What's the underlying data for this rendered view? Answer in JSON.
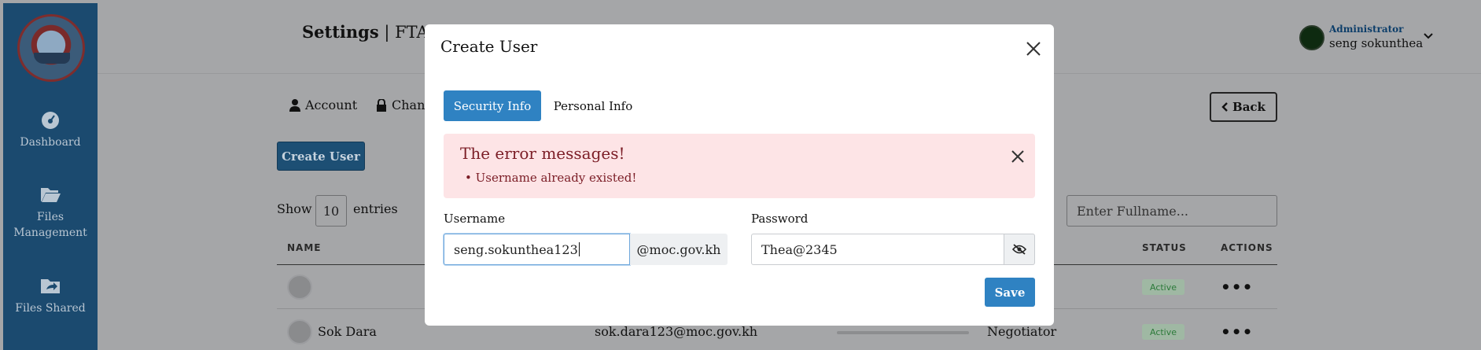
{
  "sidebar": {
    "items": [
      {
        "label": "Dashboard",
        "icon": "gauge-icon"
      },
      {
        "label": "Files Management",
        "icon": "folder-open-icon"
      },
      {
        "label": "Files Shared",
        "icon": "folder-share-icon"
      }
    ]
  },
  "header": {
    "title_bold": "Settings",
    "title_rest": " | FTA K",
    "user_role": "Administrator",
    "user_name": "seng sokunthea"
  },
  "tabs": {
    "account": "Account",
    "change": "Chang"
  },
  "back_label": "Back",
  "create_user_label": "Create User",
  "table": {
    "show_label": "Show",
    "entries_value": "10",
    "entries_label": "entries",
    "fullname_placeholder": "Enter Fullname...",
    "headers": {
      "name": "NAME",
      "status": "STATUS",
      "actions": "ACTIONS"
    },
    "rows": [
      {
        "name": "",
        "email": "",
        "role": "",
        "status": "Active"
      },
      {
        "name": "Sok Dara",
        "email": "sok.dara123@moc.gov.kh",
        "role": "Negotiator",
        "status": "Active"
      }
    ]
  },
  "modal": {
    "title": "Create User",
    "tabs": {
      "security": "Security Info",
      "personal": "Personal Info"
    },
    "alert": {
      "title": "The error messages!",
      "items": [
        "• Username already existed!"
      ]
    },
    "username": {
      "label": "Username",
      "value": "seng.sokunthea123",
      "suffix": "@moc.gov.kh"
    },
    "password": {
      "label": "Password",
      "value": "Thea@2345"
    },
    "save_label": "Save"
  },
  "colors": {
    "sidebar": "#1b4a6f",
    "primary": "#2f82c2",
    "alert_bg": "#fde4e6",
    "alert_text": "#7b1d26"
  }
}
